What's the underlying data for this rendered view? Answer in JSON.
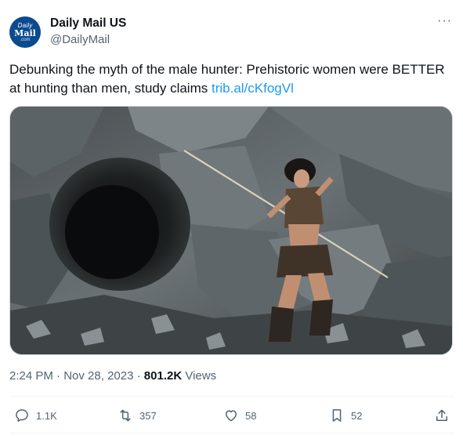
{
  "author": {
    "avatar_lines": [
      "Daily",
      "Mail",
      ".com"
    ],
    "name": "Daily Mail US",
    "handle": "@DailyMail"
  },
  "more_icon": "more-dots-icon",
  "tweet": {
    "text": "Debunking the myth of the male hunter: Prehistoric women were BETTER at hunting than men, study claims ",
    "link": "trib.al/cKfogVl"
  },
  "meta": {
    "time": "2:24 PM",
    "date": "Nov 28, 2023",
    "separator": "·",
    "views": "801.2K",
    "views_label": "Views"
  },
  "actions": {
    "replies": "1.1K",
    "reposts": "357",
    "likes": "58",
    "bookmarks": "52"
  },
  "colors": {
    "link": "#1d9bf0",
    "secondary_text": "#536471",
    "brand_avatar": "#0a4a8f"
  }
}
